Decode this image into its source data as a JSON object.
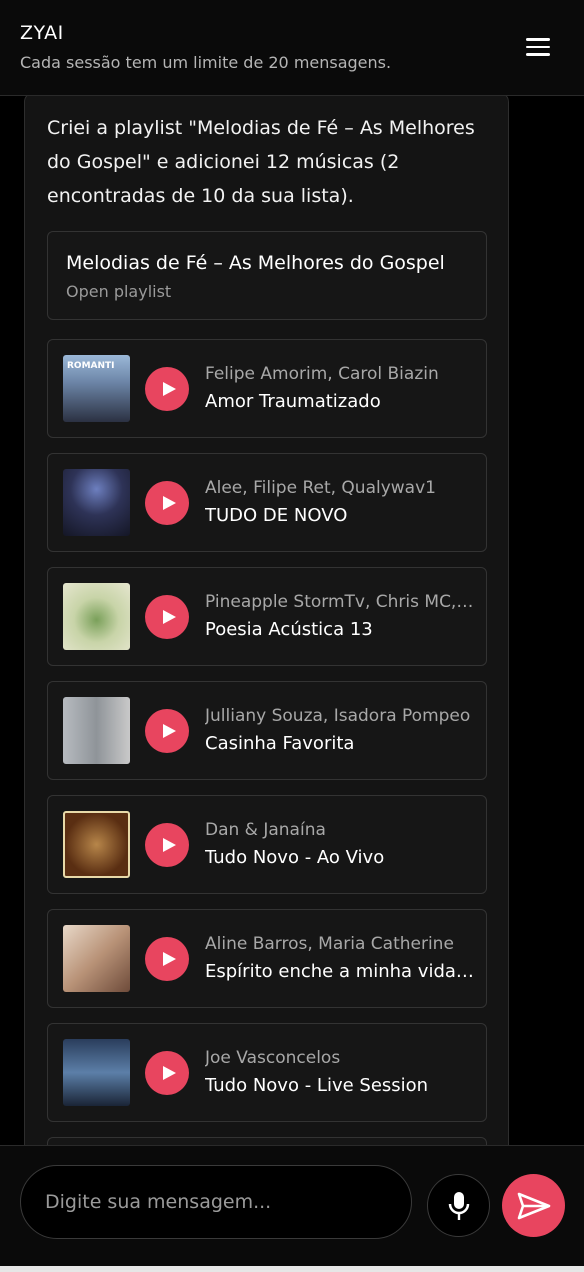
{
  "header": {
    "title": "ZYAI",
    "subtitle": "Cada sessão tem um limite de 20 mensagens.",
    "menu_icon": "hamburger-menu-icon"
  },
  "message": {
    "text": "Criei a playlist \"Melodias de Fé – As Melhores do Gospel\" e adicionei 12 músicas (2 encontradas de 10 da sua lista)."
  },
  "playlist": {
    "name": "Melodias de Fé – As Melhores do Gospel",
    "link_label": "Open playlist"
  },
  "tracks": [
    {
      "artist": "Felipe Amorim, Carol Biazin",
      "title": "Amor Traumatizado",
      "cover_label": "ROMANTI"
    },
    {
      "artist": "Alee, Filipe Ret, Qualywav1",
      "title": "TUDO DE NOVO",
      "cover_label": ""
    },
    {
      "artist": "Pineapple StormTv, Chris MC, Mariana Froes",
      "title": "Poesia Acústica 13",
      "cover_label": ""
    },
    {
      "artist": "Julliany Souza, Isadora Pompeo",
      "title": "Casinha Favorita",
      "cover_label": ""
    },
    {
      "artist": "Dan & Janaína",
      "title": "Tudo Novo - Ao Vivo",
      "cover_label": ""
    },
    {
      "artist": "Aline Barros, Maria Catherine",
      "title": "Espírito enche a minha vida - Ao Vivo",
      "cover_label": ""
    },
    {
      "artist": "Joe Vasconcelos",
      "title": "Tudo Novo - Live Session",
      "cover_label": ""
    }
  ],
  "composer": {
    "placeholder": "Digite sua mensagem...",
    "mic_icon": "microphone-icon",
    "send_icon": "send-icon"
  },
  "colors": {
    "accent": "#e8455f",
    "background": "#000000",
    "card": "#161616"
  }
}
